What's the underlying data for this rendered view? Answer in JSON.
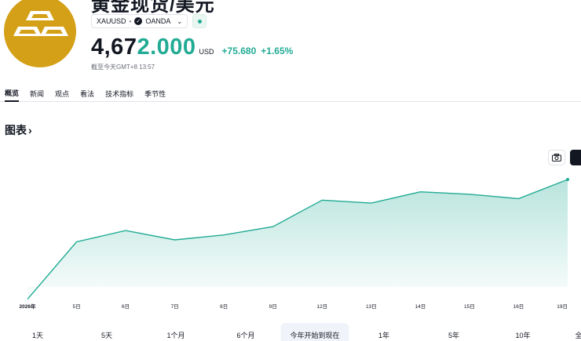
{
  "header": {
    "title": "黄金现货/美元",
    "symbol": "XAUUSD",
    "separator": "•",
    "broker": "OANDA",
    "price_int": "4,67",
    "price_frac": "2.000",
    "currency": "USD",
    "change_abs": "+75.680",
    "change_pct": "+1.65%",
    "as_of": "截至今天GMT+8 13:57"
  },
  "tabs": [
    {
      "label": "概览",
      "active": true
    },
    {
      "label": "新闻"
    },
    {
      "label": "观点"
    },
    {
      "label": "看法"
    },
    {
      "label": "技术指标"
    },
    {
      "label": "季节性"
    }
  ],
  "section": {
    "title": "图表",
    "arrow": "›"
  },
  "ranges": [
    {
      "label": "1天"
    },
    {
      "label": "5天"
    },
    {
      "label": "1个月"
    },
    {
      "label": "6个月"
    },
    {
      "label": "今年开始到现在",
      "active": true
    },
    {
      "label": "1年"
    },
    {
      "label": "5年"
    },
    {
      "label": "10年"
    },
    {
      "label": "全"
    }
  ],
  "colors": {
    "accent": "#22ab94",
    "logo": "#d4a017"
  },
  "chart_data": {
    "type": "area",
    "x": [
      "2026年",
      "5日",
      "6日",
      "7日",
      "8日",
      "9日",
      "12日",
      "13日",
      "14日",
      "15日",
      "16日",
      "19日"
    ],
    "values": [
      4330,
      4447,
      4470,
      4451,
      4461,
      4478,
      4532,
      4526,
      4549,
      4544,
      4535,
      4574
    ],
    "ylim": [
      4328,
      4582
    ],
    "grid": false,
    "line_color": "#22ab94"
  }
}
